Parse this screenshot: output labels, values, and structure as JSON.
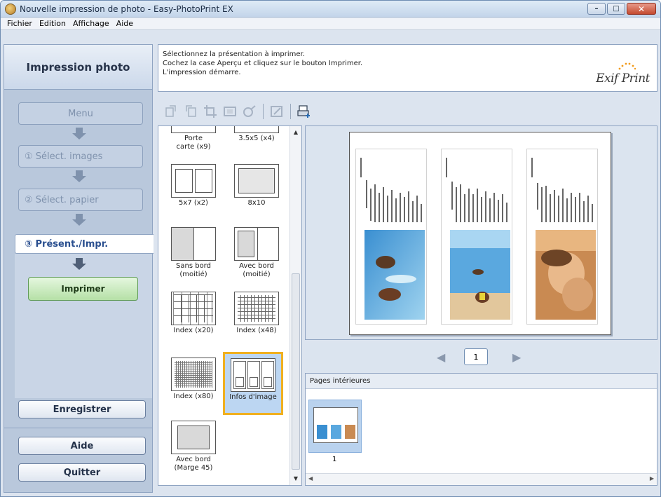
{
  "window": {
    "title": "Nouvelle impression de photo - Easy-PhotoPrint EX",
    "controls": [
      "minimize",
      "maximize",
      "close"
    ]
  },
  "menubar": [
    "Fichier",
    "Edition",
    "Affichage",
    "Aide"
  ],
  "sidebar": {
    "heading": "Impression photo",
    "steps": [
      {
        "label": "Menu"
      },
      {
        "label": "① Sélect. images"
      },
      {
        "label": "② Sélect. papier"
      },
      {
        "label": "③ Présent./Impr."
      }
    ],
    "print_button": "Imprimer",
    "save_button": "Enregistrer",
    "help_button": "Aide",
    "quit_button": "Quitter"
  },
  "instructions": {
    "line1": "Sélectionnez la présentation à imprimer.",
    "line2": "Cochez la case Aperçu et cliquez sur le bouton Imprimer.",
    "line3": "L'impression démarre.",
    "logo": "Exif Print"
  },
  "toolbar_icons": [
    "rotate-left-icon",
    "rotate-right-icon",
    "crop-icon",
    "frame-icon",
    "correct-icon",
    "date-icon",
    "print-settings-icon"
  ],
  "layouts": [
    {
      "label": "Porte\ncarte (x9)"
    },
    {
      "label": "3.5x5 (x4)"
    },
    {
      "label": "5x7 (x2)"
    },
    {
      "label": "8x10"
    },
    {
      "label": "Sans bord\n(moitié)"
    },
    {
      "label": "Avec bord\n(moitié)"
    },
    {
      "label": "Index (x20)"
    },
    {
      "label": "Index (x48)"
    },
    {
      "label": "Index (x80)"
    },
    {
      "label": "Infos d'image"
    },
    {
      "label": "Avec bord\n(Marge 45)"
    }
  ],
  "selected_layout": "Infos d'image",
  "preview": {
    "page_number": "1"
  },
  "inner_pages": {
    "header": "Pages intérieures",
    "items": [
      {
        "number": "1"
      }
    ]
  },
  "colors": {
    "selected_border": "#f0b020",
    "print_button": "#b5e0a6",
    "active_step_text": "#2a4f8f"
  }
}
